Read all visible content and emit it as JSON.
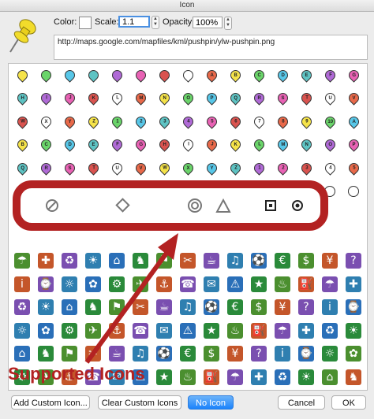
{
  "window": {
    "title": "Icon"
  },
  "controls": {
    "color_label": "Color:",
    "scale_label": "Scale:",
    "scale_value": "1.1",
    "opacity_label": "Opacity:",
    "opacity_value": "100%",
    "icon_url": "http://maps.google.com/mapfiles/kml/pushpin/ylw-pushpin.png"
  },
  "callout_caption": "Supported Icons",
  "buttons": {
    "add_custom": "Add Custom Icon...",
    "clear_custom": "Clear Custom Icons",
    "no_icon": "No Icon",
    "cancel": "Cancel",
    "ok": "OK"
  },
  "pin_letters": [
    "A",
    "B",
    "C",
    "D",
    "E",
    "F",
    "G",
    "H",
    "I",
    "J",
    "K",
    "L",
    "M",
    "N",
    "O",
    "P",
    "Q",
    "R",
    "S",
    "T",
    "U",
    "V",
    "W",
    "X",
    "Y",
    "Z",
    "1",
    "2",
    "3",
    "4",
    "5",
    "6",
    "7",
    "8",
    "9",
    "10"
  ],
  "colors": {
    "accent": "#b32222",
    "selected_button": "#1a82fb"
  }
}
